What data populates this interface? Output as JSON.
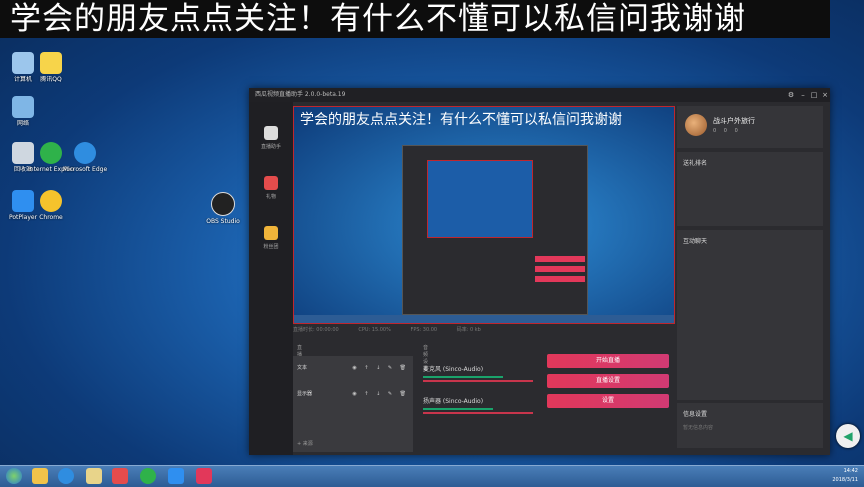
{
  "banner": {
    "text": "学会的朋友点点关注！有什么不懂可以私信问我谢谢"
  },
  "desktop_icons": [
    {
      "label": "计算机"
    },
    {
      "label": "腾讯QQ"
    },
    {
      "label": "网络"
    },
    {
      "label": "回收站"
    },
    {
      "label": "Internet Explorer"
    },
    {
      "label": "Microsoft Edge"
    },
    {
      "label": "PotPlayer"
    },
    {
      "label": "Chrome"
    },
    {
      "label": "OBS Studio"
    }
  ],
  "app": {
    "title": "西瓜视频直播助手 2.0.0-beta.19",
    "nav": [
      {
        "label": "直播助手",
        "icon": "person-icon"
      },
      {
        "label": "礼物",
        "icon": "gift-icon"
      },
      {
        "label": "粉丝团",
        "icon": "crown-icon"
      }
    ],
    "preview_banner": "学会的朋友点点关注！有什么不懂可以私信问我谢谢",
    "status": [
      "直播时长: 00:00:00",
      "CPU: 15.00%",
      "FPS: 30.00",
      "码率: 0 kb"
    ],
    "user": {
      "name": "战斗户外旅行",
      "stats": [
        "0",
        "0",
        "0"
      ]
    },
    "right_panels": {
      "gifts": "送礼排名",
      "chat": "互动聊天",
      "info": "信息设置",
      "info_sub": "暂无信息内容"
    },
    "scenes_head": "直播内容设置",
    "scenes": [
      {
        "label": "文本"
      },
      {
        "label": "显示器"
      }
    ],
    "scene_add": "+ 来源",
    "audio_head": "音频设置",
    "audio": [
      {
        "label": "麦克风 (Sinco-Audio)"
      },
      {
        "label": "扬声器 (Sinco-Audio)"
      }
    ],
    "buttons": {
      "start": "开始直播",
      "settings": "直播设置",
      "more": "设置"
    }
  },
  "taskbar": {
    "time": "14:42",
    "date": "2018/3/11"
  },
  "colors": {
    "accent": "#e2385a",
    "panel": "#2b2b2f"
  }
}
